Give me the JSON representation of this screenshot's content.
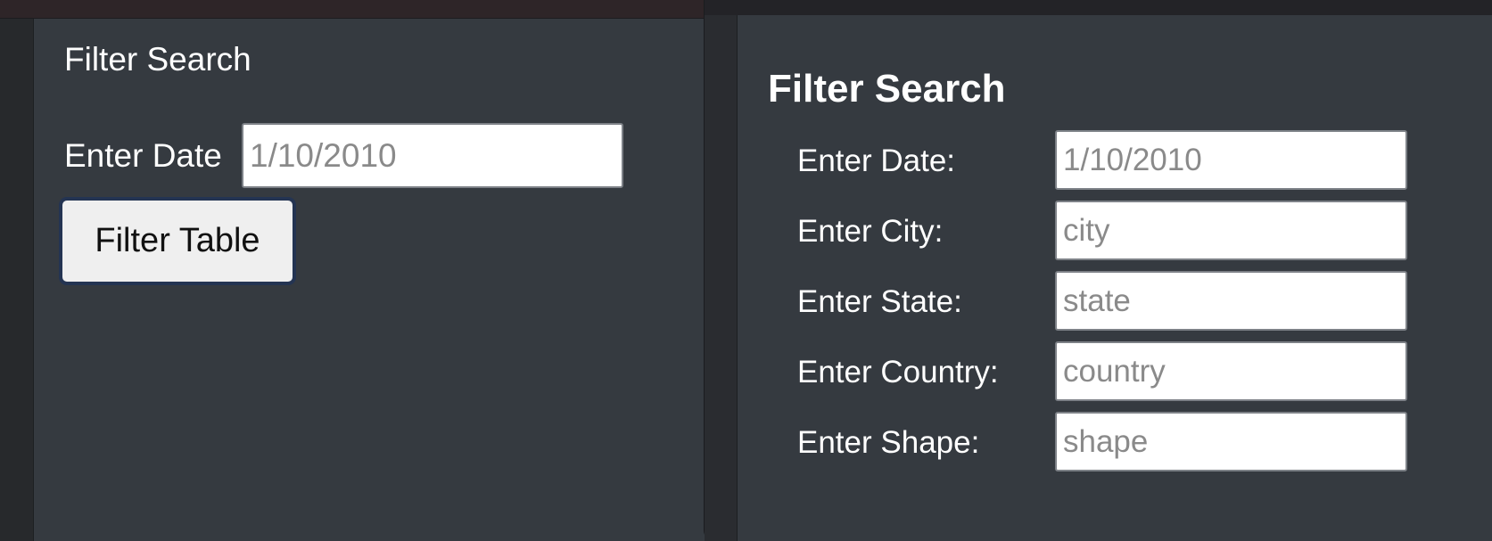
{
  "left_panel": {
    "heading": "Filter Search",
    "date_label": "Enter Date",
    "date_placeholder": "1/10/2010",
    "button_label": "Filter Table"
  },
  "right_panel": {
    "heading": "Filter Search",
    "fields": [
      {
        "label": "Enter Date:",
        "placeholder": "1/10/2010"
      },
      {
        "label": "Enter City:",
        "placeholder": "city"
      },
      {
        "label": "Enter State:",
        "placeholder": "state"
      },
      {
        "label": "Enter Country:",
        "placeholder": "country"
      },
      {
        "label": "Enter Shape:",
        "placeholder": "shape"
      }
    ]
  }
}
